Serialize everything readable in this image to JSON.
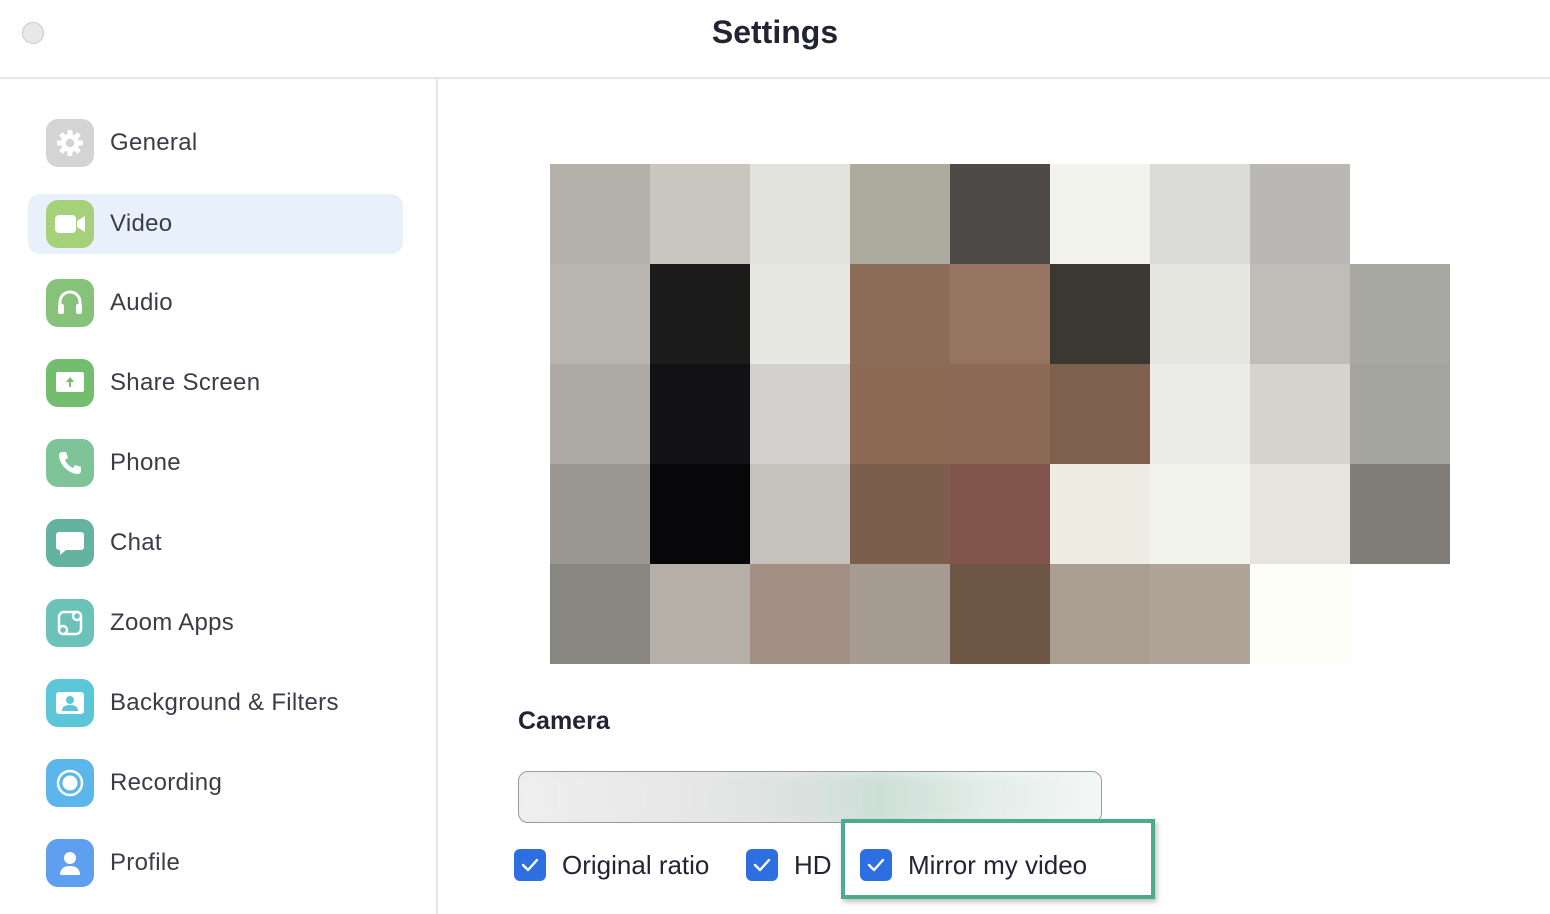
{
  "window": {
    "title": "Settings"
  },
  "sidebar": {
    "items": [
      {
        "label": "General",
        "icon": "gear-icon",
        "color": "#cfcfcf",
        "active": false
      },
      {
        "label": "Video",
        "icon": "video-camera-icon",
        "color": "#a5d17a",
        "active": true
      },
      {
        "label": "Audio",
        "icon": "headphones-icon",
        "color": "#86c27a",
        "active": false
      },
      {
        "label": "Share Screen",
        "icon": "share-screen-icon",
        "color": "#74bd6f",
        "active": false
      },
      {
        "label": "Phone",
        "icon": "phone-icon",
        "color": "#7fc499",
        "active": false
      },
      {
        "label": "Chat",
        "icon": "chat-bubble-icon",
        "color": "#64b2a0",
        "active": false
      },
      {
        "label": "Zoom Apps",
        "icon": "apps-icon",
        "color": "#6bc2b8",
        "active": false
      },
      {
        "label": "Background & Filters",
        "icon": "background-person-icon",
        "color": "#5cc6d9",
        "active": false
      },
      {
        "label": "Recording",
        "icon": "record-icon",
        "color": "#5bb7eb",
        "active": false
      },
      {
        "label": "Profile",
        "icon": "profile-icon",
        "color": "#5f9ff0",
        "active": false
      }
    ],
    "active_color": "#e8f0fc"
  },
  "video_preview": {
    "pixels": [
      [
        "#b3b0aa",
        "#c9c6c0",
        "#e2e2dd",
        "#adaa9e",
        "#4e4a47",
        "#f2f3ec",
        "#dbdcd7",
        "#b9b8b4",
        null
      ],
      [
        "#b8b4ae",
        "#1b1b1c",
        "#e8e8e3",
        "#8a6c58",
        "#957561",
        "#3b3832",
        "#e4e6df",
        "#bebdb8",
        "#a8a8a2"
      ],
      [
        "#adaaa5",
        "#121113",
        "#d2d1cd",
        "#8c6a53",
        "#8c6a56",
        "#7e604f",
        "#ebebe7",
        "#d6d3cf",
        "#a4a49f"
      ],
      [
        "#9a9690",
        "#07070a",
        "#c4c2bb",
        "#7b5e4b",
        "#81554b",
        "#ededE4",
        "#f2f3ed",
        "#e7e3de",
        "#807d76"
      ],
      [
        "#878680",
        "#b6afa8",
        "#a19083",
        "#a59b90",
        "#6e5644",
        "#aa9e91",
        "#b0a398",
        "#fefef9",
        "#fefefe"
      ]
    ]
  },
  "camera": {
    "section_label": "Camera",
    "selected_value": ""
  },
  "options": [
    {
      "label": "Original ratio",
      "checked": true
    },
    {
      "label": "HD",
      "checked": true
    },
    {
      "label": "Mirror my video",
      "checked": true
    }
  ],
  "colors": {
    "checkbox": "#2d6fe0",
    "highlight": "#4aab90"
  }
}
